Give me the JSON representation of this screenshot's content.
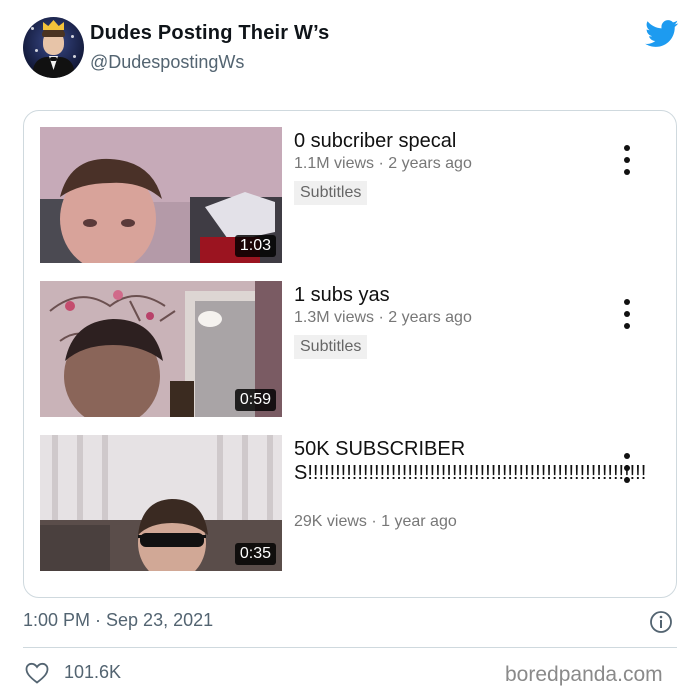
{
  "tweet": {
    "display_name": "Dudes Posting Their W’s",
    "handle": "@DudespostingWs",
    "timestamp": "1:00 PM · Sep 23, 2021",
    "like_count": "101.6K"
  },
  "videos": [
    {
      "title": "0 subcriber specal",
      "meta": "1.1M views · 2 years ago",
      "badge": "Subtitles",
      "duration": "1:03"
    },
    {
      "title": "1 subs yas",
      "meta": "1.3M views · 2 years ago",
      "badge": "Subtitles",
      "duration": "0:59"
    },
    {
      "title": "50K SUBSCRIBERS!!!!!!!!!!!!!!!!!!!!!!!!!!!!!!!!!!!!!!!!!!!!!!!!!!!!!!!!!!!!!",
      "meta": "29K views · 1 year ago",
      "duration": "0:35"
    }
  ],
  "watermark": "boredpanda.com",
  "icons": {
    "brand": "twitter-bird-icon",
    "more": "more-vertical-icon",
    "info": "info-icon",
    "like": "heart-icon"
  },
  "colors": {
    "twitter_blue": "#1d9bf0",
    "secondary_text": "#536471",
    "border": "#cfd9de"
  }
}
